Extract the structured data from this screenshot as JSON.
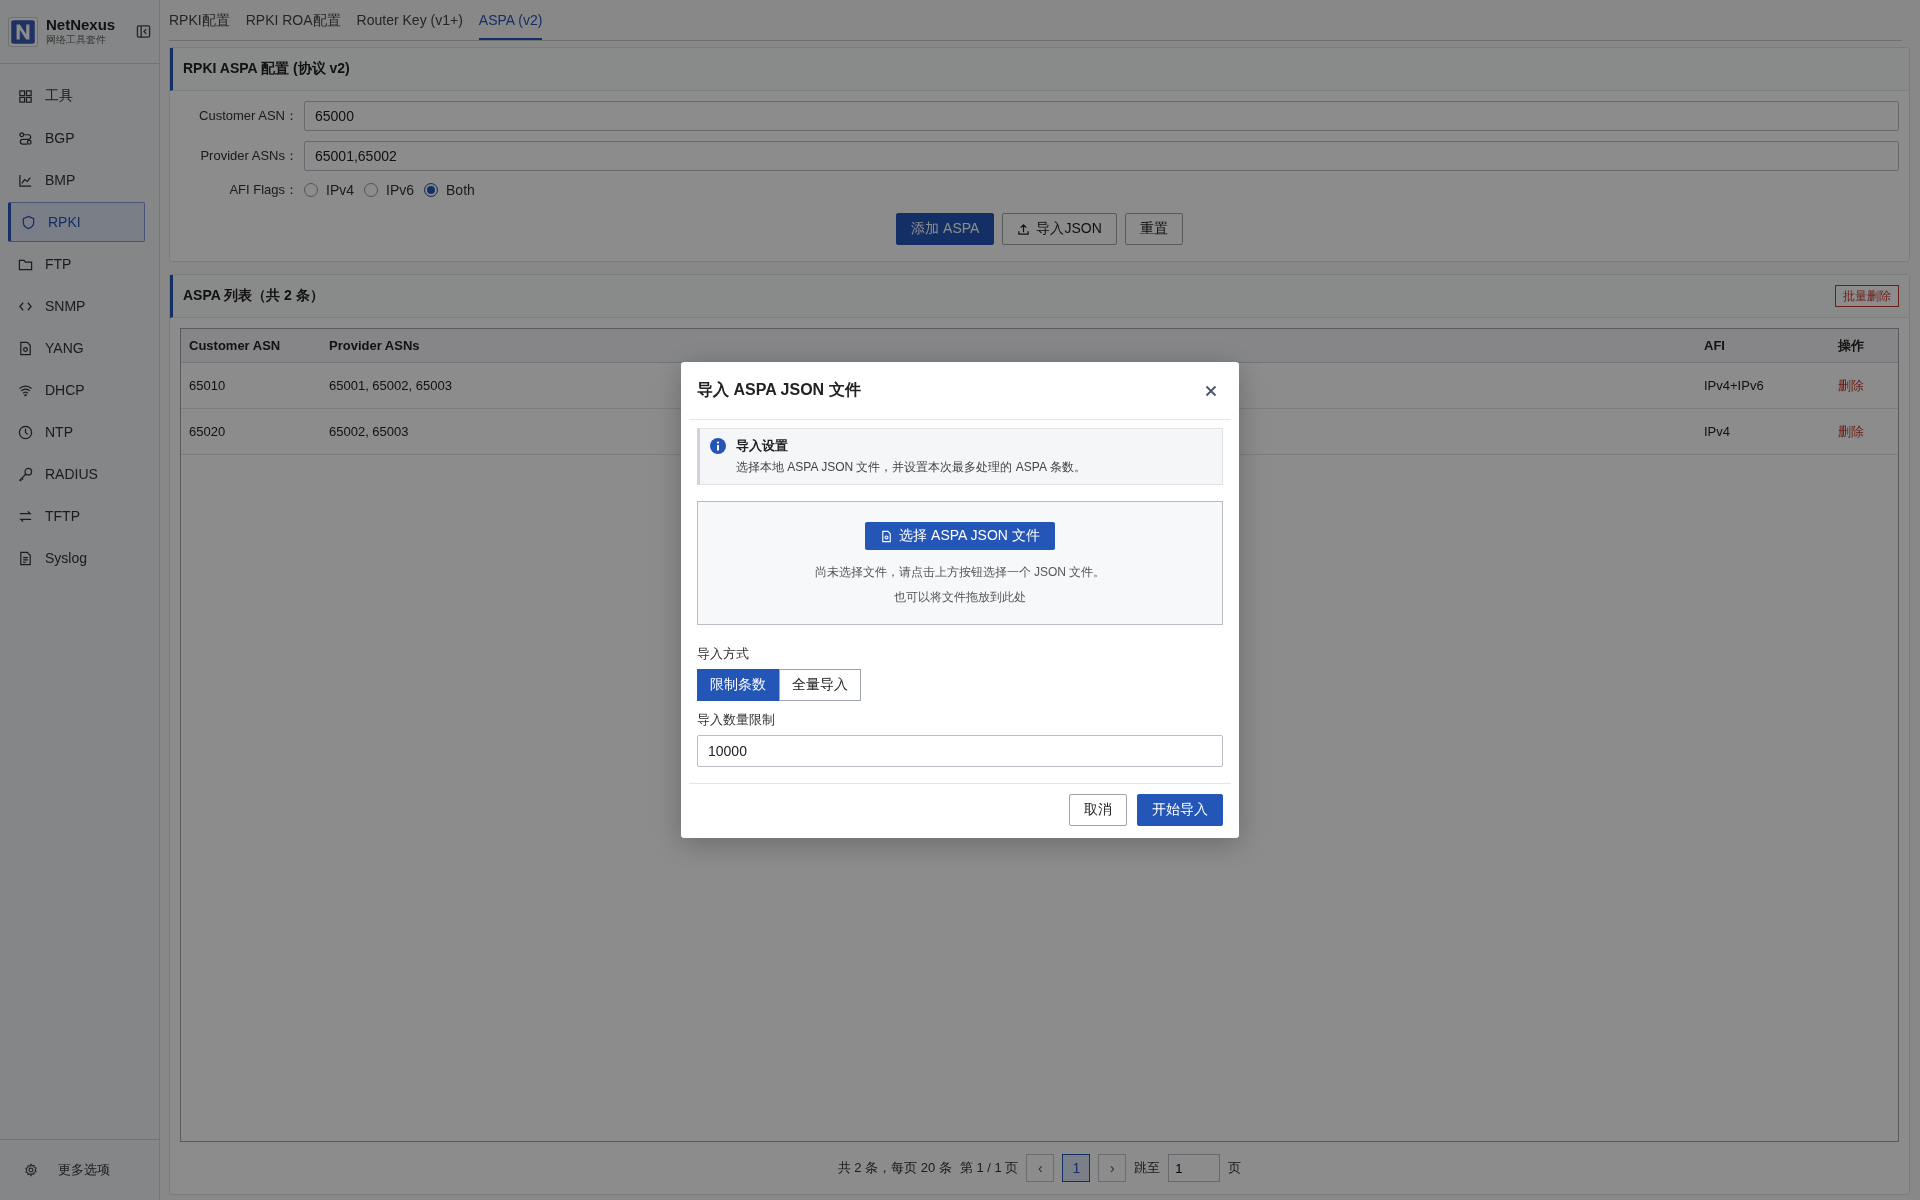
{
  "app": {
    "name": "NetNexus",
    "subtitle": "网络工具套件"
  },
  "sidebar": {
    "items": [
      {
        "label": "工具",
        "selected": false
      },
      {
        "label": "BGP",
        "selected": false
      },
      {
        "label": "BMP",
        "selected": false
      },
      {
        "label": "RPKI",
        "selected": true
      },
      {
        "label": "FTP",
        "selected": false
      },
      {
        "label": "SNMP",
        "selected": false
      },
      {
        "label": "YANG",
        "selected": false
      },
      {
        "label": "DHCP",
        "selected": false
      },
      {
        "label": "NTP",
        "selected": false
      },
      {
        "label": "RADIUS",
        "selected": false
      },
      {
        "label": "TFTP",
        "selected": false
      },
      {
        "label": "Syslog",
        "selected": false
      }
    ],
    "footer": "更多选项"
  },
  "tabs": [
    {
      "label": "RPKI配置",
      "selected": false
    },
    {
      "label": "RPKI ROA配置",
      "selected": false
    },
    {
      "label": "Router Key (v1+)",
      "selected": false
    },
    {
      "label": "ASPA (v2)",
      "selected": true
    }
  ],
  "config": {
    "title": "RPKI ASPA 配置 (协议 v2)",
    "fields": [
      {
        "label": "Customer ASN：",
        "value": "65000"
      },
      {
        "label": "Provider ASNs：",
        "value": "65001,65002"
      }
    ],
    "afi": {
      "label": "AFI Flags：",
      "options": [
        {
          "label": "IPv4",
          "selected": false
        },
        {
          "label": "IPv6",
          "selected": false
        },
        {
          "label": "Both",
          "selected": true
        }
      ]
    },
    "buttons": [
      {
        "label": "添加 ASPA",
        "kind": "primary"
      },
      {
        "label": "导入JSON",
        "kind": "import"
      },
      {
        "label": "重置",
        "kind": "default"
      }
    ]
  },
  "list": {
    "title": "ASPA 列表（共 2 条）",
    "bulk_delete": "批量删除",
    "columns": [
      "Customer ASN",
      "Provider ASNs",
      "AFI",
      "操作"
    ],
    "rows": [
      {
        "cells": [
          "65010",
          "65001, 65002, 65003",
          "IPv4+IPv6"
        ],
        "action": "删除"
      },
      {
        "cells": [
          "65020",
          "65002, 65003",
          "IPv4"
        ],
        "action": "删除"
      }
    ]
  },
  "pagination": {
    "summary": "共 2 条，每页 20 条",
    "page_info": "第 1 / 1 页",
    "prev": "‹",
    "pages": [
      {
        "label": "1",
        "selected": true
      }
    ],
    "next": "›",
    "jump_label": "跳至",
    "jump_value": "1",
    "unit": "页"
  },
  "dialog": {
    "title": "导入 ASPA JSON 文件",
    "info": {
      "title": "导入设置",
      "text": "选择本地 ASPA JSON 文件，并设置本次最多处理的 ASPA 条数。"
    },
    "file_button": "选择 ASPA JSON 文件",
    "hints": [
      "尚未选择文件，请点击上方按钮选择一个 JSON 文件。",
      "也可以将文件拖放到此处"
    ],
    "mode_label": "导入方式",
    "modes": [
      {
        "label": "限制条数",
        "selected": true
      },
      {
        "label": "全量导入",
        "selected": false
      }
    ],
    "limit_label": "导入数量限制",
    "limit_value": "10000",
    "buttons": [
      {
        "label": "取消",
        "kind": "default"
      },
      {
        "label": "开始导入",
        "kind": "primary"
      }
    ]
  }
}
